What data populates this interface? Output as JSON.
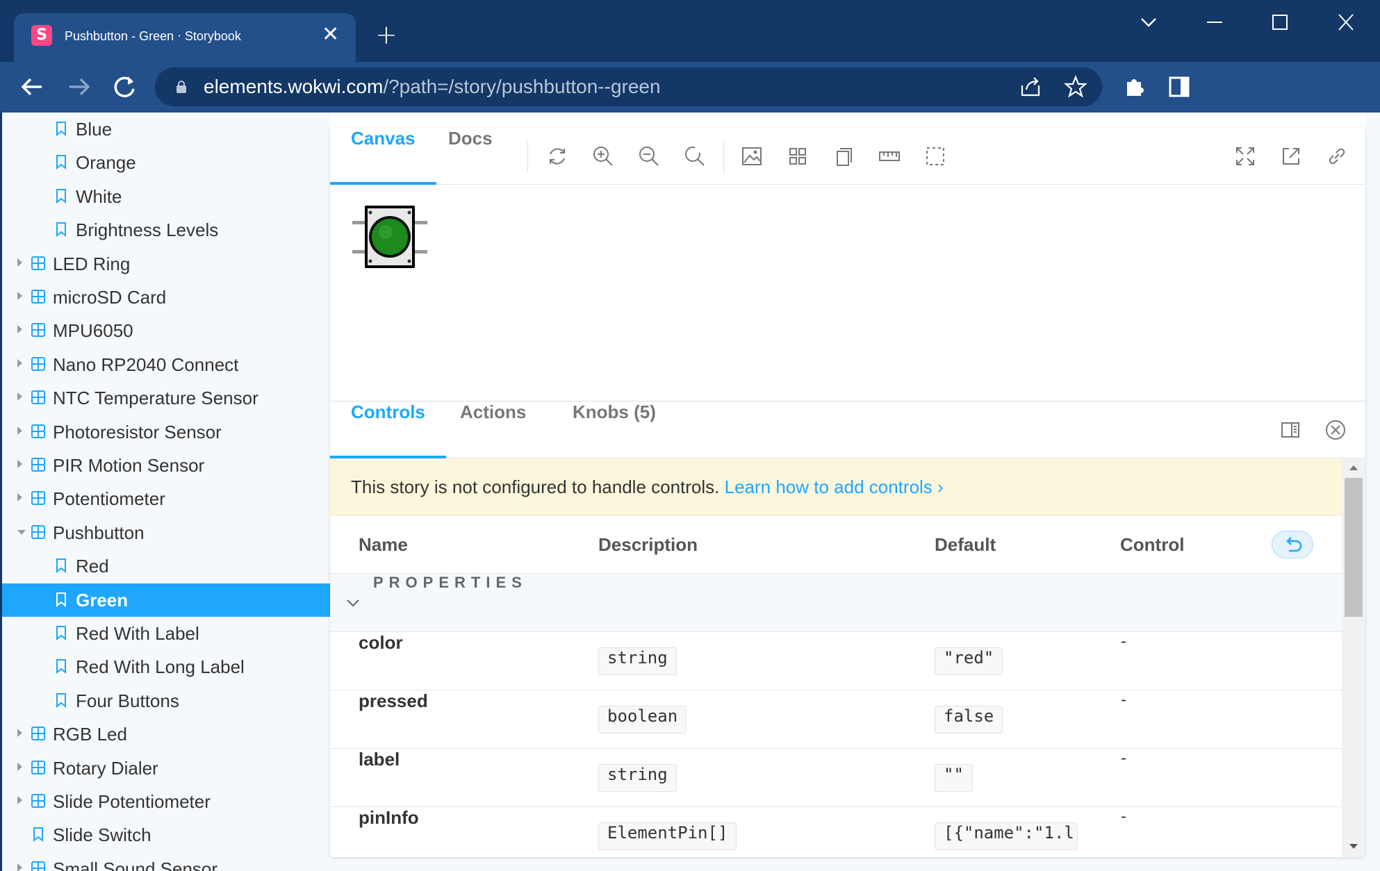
{
  "browser": {
    "tab_title": "Pushbutton - Green ⋅ Storybook",
    "tab_favicon": "S",
    "url_host": "elements.wokwi.com",
    "url_path": "/?path=/story/pushbutton--green",
    "icons": [
      "storybook-favicon-icon",
      "close-icon",
      "plus-icon",
      "chevron-down-icon",
      "minimize-icon",
      "maximize-icon",
      "close-window-icon",
      "back-icon",
      "forward-icon",
      "reload-icon",
      "lock-icon",
      "share-icon",
      "star-icon",
      "extensions-icon",
      "sidebar-icon"
    ]
  },
  "sidebar": {
    "items": [
      {
        "label": "Blue",
        "type": "story",
        "level": 2
      },
      {
        "label": "Orange",
        "type": "story",
        "level": 2
      },
      {
        "label": "White",
        "type": "story",
        "level": 2
      },
      {
        "label": "Brightness Levels",
        "type": "story",
        "level": 2
      },
      {
        "label": "LED Ring",
        "type": "component",
        "level": 1,
        "expanded": false
      },
      {
        "label": "microSD Card",
        "type": "component",
        "level": 1,
        "expanded": false
      },
      {
        "label": "MPU6050",
        "type": "component",
        "level": 1,
        "expanded": false
      },
      {
        "label": "Nano RP2040 Connect",
        "type": "component",
        "level": 1,
        "expanded": false
      },
      {
        "label": "NTC Temperature Sensor",
        "type": "component",
        "level": 1,
        "expanded": false
      },
      {
        "label": "Photoresistor Sensor",
        "type": "component",
        "level": 1,
        "expanded": false
      },
      {
        "label": "PIR Motion Sensor",
        "type": "component",
        "level": 1,
        "expanded": false
      },
      {
        "label": "Potentiometer",
        "type": "component",
        "level": 1,
        "expanded": false
      },
      {
        "label": "Pushbutton",
        "type": "component",
        "level": 1,
        "expanded": true
      },
      {
        "label": "Red",
        "type": "story",
        "level": 2
      },
      {
        "label": "Green",
        "type": "story",
        "level": 2,
        "selected": true
      },
      {
        "label": "Red With Label",
        "type": "story",
        "level": 2
      },
      {
        "label": "Red With Long Label",
        "type": "story",
        "level": 2
      },
      {
        "label": "Four Buttons",
        "type": "story",
        "level": 2
      },
      {
        "label": "RGB Led",
        "type": "component",
        "level": 1,
        "expanded": false
      },
      {
        "label": "Rotary Dialer",
        "type": "component",
        "level": 1,
        "expanded": false
      },
      {
        "label": "Slide Potentiometer",
        "type": "component",
        "level": 1,
        "expanded": false
      },
      {
        "label": "Slide Switch",
        "type": "story",
        "level": 1
      },
      {
        "label": "Small Sound Sensor",
        "type": "component",
        "level": 1,
        "expanded": false
      }
    ]
  },
  "toolbar": {
    "tabs": [
      "Canvas",
      "Docs"
    ],
    "active_tab": "Canvas"
  },
  "addons": {
    "tabs": [
      "Controls",
      "Actions",
      "Knobs (5)"
    ],
    "active_tab": "Controls"
  },
  "banner": {
    "text": "This story is not configured to handle controls. ",
    "link": "Learn how to add controls",
    "link_chevron": "›"
  },
  "table": {
    "headers": [
      "Name",
      "Description",
      "Default",
      "Control"
    ],
    "section": "PROPERTIES",
    "rows": [
      {
        "name": "color",
        "type": "string",
        "default": "\"red\"",
        "control": "-"
      },
      {
        "name": "pressed",
        "type": "boolean",
        "default": "false",
        "control": "-"
      },
      {
        "name": "label",
        "type": "string",
        "default": "\"\"",
        "control": "-"
      },
      {
        "name": "pinInfo",
        "type": "ElementPin[]",
        "default": "[{\"name\":\"1.l",
        "control": "-"
      }
    ]
  },
  "colors": {
    "accent": "#1ea7fd",
    "browser_dark": "#133766",
    "browser_toolbar": "#234f8a",
    "button_color": "#1c8a1c",
    "banner_bg": "#fcf6dc"
  }
}
